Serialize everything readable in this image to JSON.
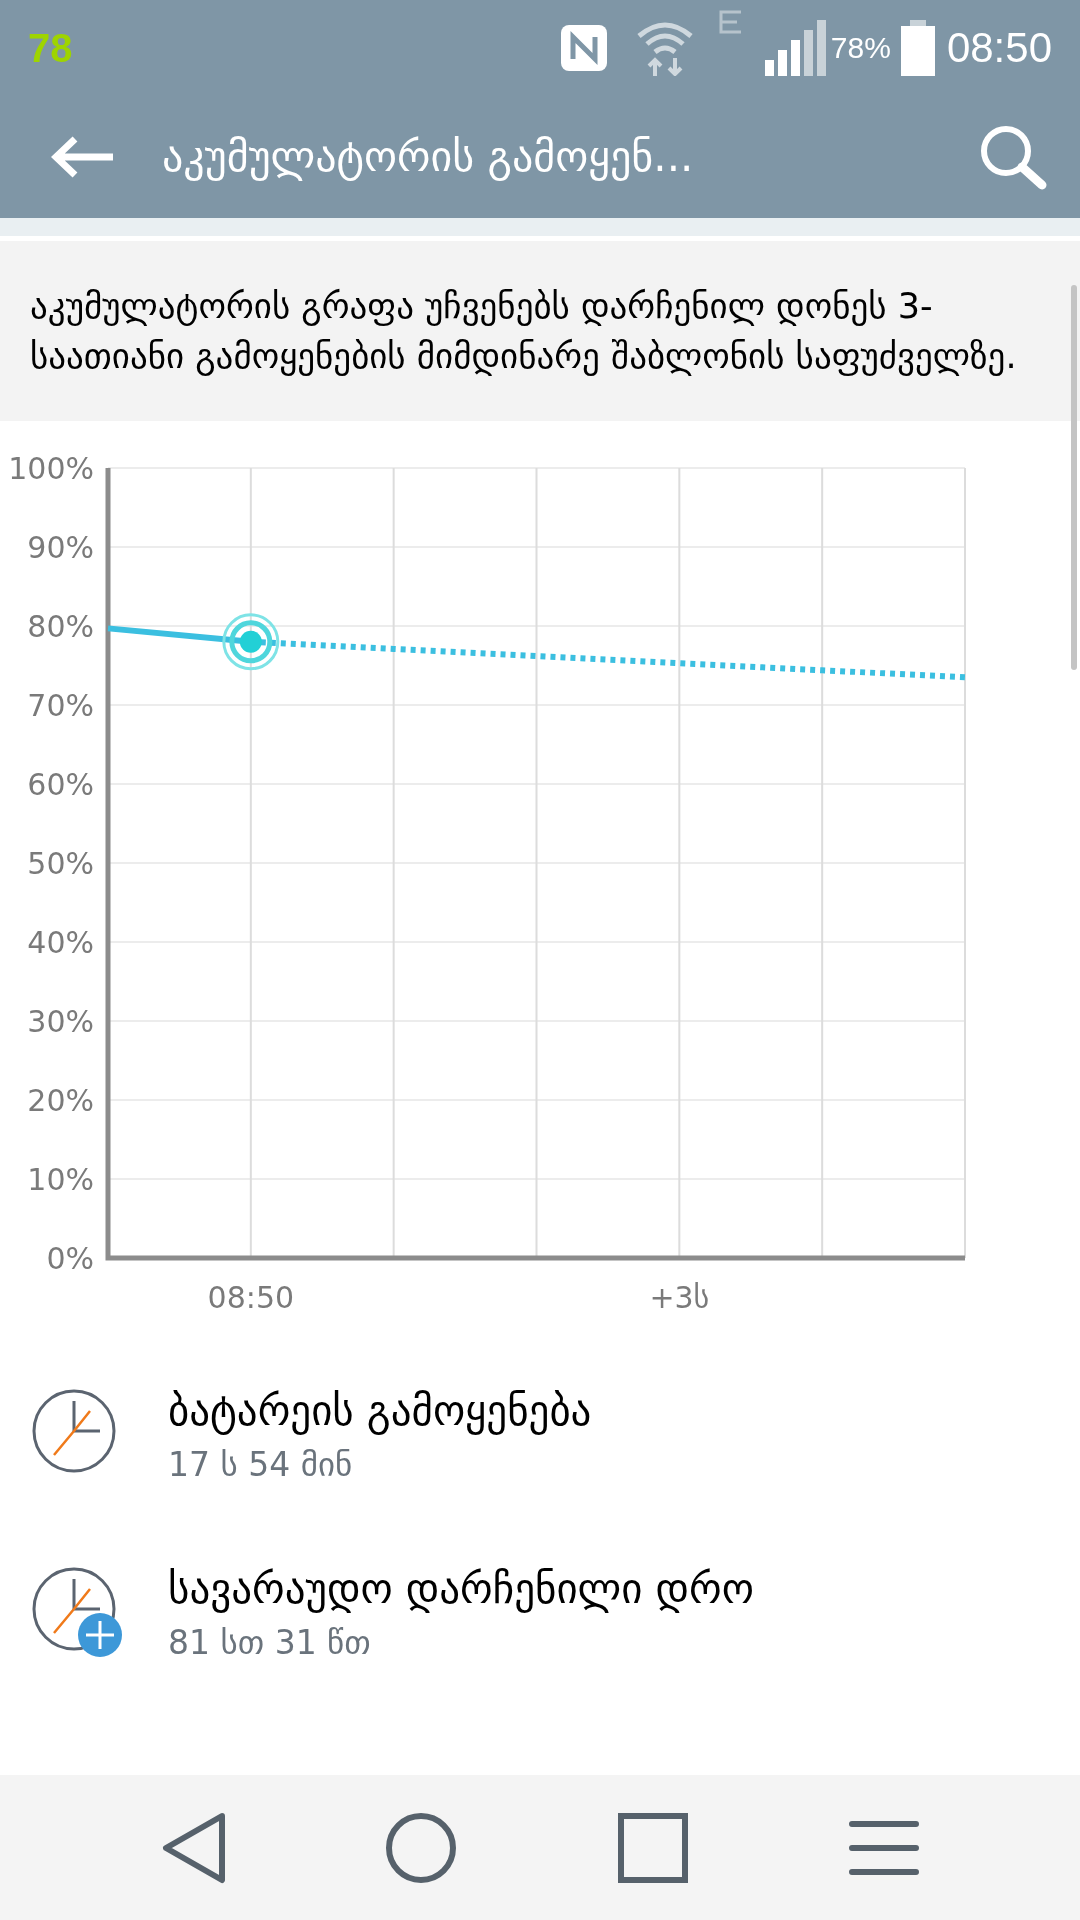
{
  "status_bar": {
    "left_number": "78",
    "battery_percent": "78%",
    "time": "08:50"
  },
  "app_bar": {
    "title": "აკუმულატორის გამოყენ..."
  },
  "description": "აკუმულატორის გრაფა უჩვენებს დარჩენილ დონეს 3-საათიანი გამოყენების მიმდინარე შაბლონის საფუძველზე.",
  "chart": {
    "chart_data": {
      "type": "line",
      "categories": [
        null,
        "08:50",
        null,
        null,
        "+3ს",
        null,
        null
      ],
      "series": [
        {
          "color": "#3bbfe0",
          "line_style": "solid",
          "values": [
            79.7,
            78,
            null,
            null,
            null,
            null,
            null
          ]
        },
        {
          "color": "#3bbfe0",
          "line_style": "dotted",
          "values": [
            null,
            78,
            77.1,
            76.2,
            75.3,
            74.4,
            73.5
          ]
        }
      ],
      "grid": true,
      "ylim": [
        0,
        100
      ],
      "yticks": [
        {
          "value": 0,
          "label": "0%"
        },
        {
          "value": 10,
          "label": "10%"
        },
        {
          "value": 20,
          "label": "20%"
        },
        {
          "value": 30,
          "label": "30%"
        },
        {
          "value": 40,
          "label": "40%"
        },
        {
          "value": 50,
          "label": "50%"
        },
        {
          "value": 60,
          "label": "60%"
        },
        {
          "value": 70,
          "label": "70%"
        },
        {
          "value": 80,
          "label": "80%"
        },
        {
          "value": 90,
          "label": "90%"
        },
        {
          "value": 100,
          "label": "100%"
        }
      ]
    }
  },
  "items": [
    {
      "kind": "clock",
      "title": "ბატარეის გამოყენება",
      "value": "17 ს 54 მინ"
    },
    {
      "kind": "clock-plus",
      "title": "სავარაუდო დარჩენილი დრო",
      "value": "81 სთ 31 წთ"
    }
  ]
}
